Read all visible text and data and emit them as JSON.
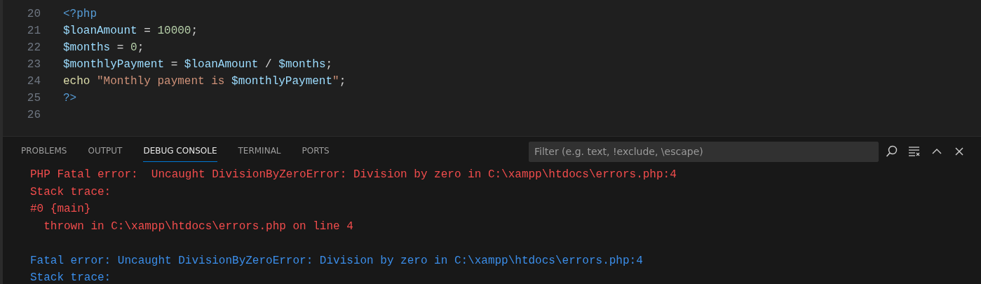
{
  "editor": {
    "lines": [
      {
        "number": "20",
        "tokens": [
          {
            "kind": "tag",
            "text": "<?php"
          }
        ]
      },
      {
        "number": "21",
        "tokens": [
          {
            "kind": "variable",
            "text": "$loanAmount"
          },
          {
            "kind": "plain",
            "text": " = "
          },
          {
            "kind": "number",
            "text": "10000"
          },
          {
            "kind": "plain",
            "text": ";"
          }
        ]
      },
      {
        "number": "22",
        "tokens": [
          {
            "kind": "variable",
            "text": "$months"
          },
          {
            "kind": "plain",
            "text": " = "
          },
          {
            "kind": "number",
            "text": "0"
          },
          {
            "kind": "plain",
            "text": ";"
          }
        ]
      },
      {
        "number": "23",
        "tokens": [
          {
            "kind": "variable",
            "text": "$monthlyPayment"
          },
          {
            "kind": "plain",
            "text": " = "
          },
          {
            "kind": "variable",
            "text": "$loanAmount"
          },
          {
            "kind": "plain",
            "text": " / "
          },
          {
            "kind": "variable",
            "text": "$months"
          },
          {
            "kind": "plain",
            "text": ";"
          }
        ]
      },
      {
        "number": "24",
        "tokens": [
          {
            "kind": "function",
            "text": "echo"
          },
          {
            "kind": "string",
            "text": " \"Monthly payment is "
          },
          {
            "kind": "variable",
            "text": "$monthlyPayment"
          },
          {
            "kind": "string",
            "text": "\""
          },
          {
            "kind": "plain",
            "text": ";"
          }
        ]
      },
      {
        "number": "25",
        "tokens": [
          {
            "kind": "tag",
            "text": "?>"
          }
        ]
      },
      {
        "number": "26"
      }
    ]
  },
  "panel": {
    "tabs": [
      {
        "label": "PROBLEMS",
        "selected": false
      },
      {
        "label": "OUTPUT",
        "selected": false
      },
      {
        "label": "DEBUG CONSOLE",
        "selected": true
      },
      {
        "label": "TERMINAL",
        "selected": false
      },
      {
        "label": "PORTS",
        "selected": false
      }
    ],
    "filter": {
      "placeholder": "Filter (e.g. text, !exclude, \\escape)"
    },
    "output": [
      {
        "kind": "stderr",
        "text": "PHP Fatal error:  Uncaught DivisionByZeroError: Division by zero in C:\\xampp\\htdocs\\errors.php:4"
      },
      {
        "kind": "stderr",
        "text": "Stack trace:"
      },
      {
        "kind": "stderr",
        "text": "#0 {main}"
      },
      {
        "kind": "stderr",
        "text": "  thrown in C:\\xampp\\htdocs\\errors.php on line 4"
      },
      {
        "kind": "blank"
      },
      {
        "kind": "stdout",
        "text": "Fatal error: Uncaught DivisionByZeroError: Division by zero in C:\\xampp\\htdocs\\errors.php:4"
      },
      {
        "kind": "stdout",
        "text": "Stack trace:"
      }
    ]
  }
}
